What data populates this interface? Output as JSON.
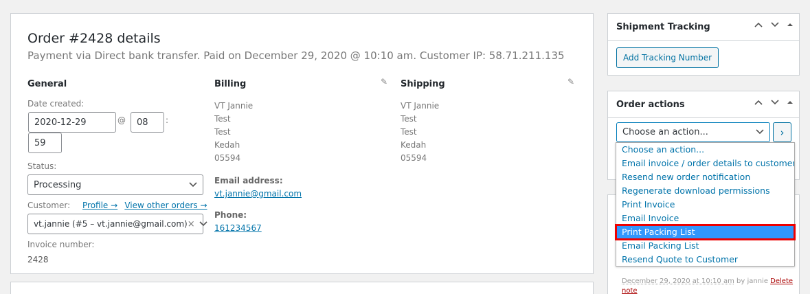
{
  "order": {
    "title": "Order #2428 details",
    "subtitle": "Payment via Direct bank transfer. Paid on December 29, 2020 @ 10:10 am. Customer IP: 58.71.211.135"
  },
  "general": {
    "heading": "General",
    "date_created_label": "Date created:",
    "date_value": "2020-12-29",
    "at_symbol": "@",
    "hour_value": "08",
    "colon": ":",
    "minute_value": "59",
    "status_label": "Status:",
    "status_value": "Processing",
    "customer_label": "Customer:",
    "profile_link": "Profile →",
    "other_orders_link": "View other orders →",
    "customer_value": "vt.jannie (#5 – vt.jannie@gmail.com)",
    "clear_glyph": "×",
    "invoice_label": "Invoice number:",
    "invoice_value": "2428"
  },
  "billing": {
    "heading": "Billing",
    "lines": [
      "VT Jannie",
      "Test",
      "Test",
      "Kedah",
      "05594"
    ],
    "email_label": "Email address:",
    "email_value": "vt.jannie@gmail.com",
    "phone_label": "Phone:",
    "phone_value": "161234567"
  },
  "shipping": {
    "heading": "Shipping",
    "lines": [
      "VT Jannie",
      "Test",
      "Test",
      "Kedah",
      "05594"
    ]
  },
  "shipment_tracking": {
    "title": "Shipment Tracking",
    "add_button": "Add Tracking Number"
  },
  "order_actions": {
    "title": "Order actions",
    "select_value": "Choose an action...",
    "go_glyph": "›",
    "options": [
      "Choose an action...",
      "Email invoice / order details to customer",
      "Resend new order notification",
      "Regenerate download permissions",
      "Print Invoice",
      "Email Invoice",
      "Print Packing List",
      "Email Packing List",
      "Resend Quote to Customer"
    ],
    "highlighted_option": "Print Packing List"
  },
  "notes": {
    "meta_text": "December 29, 2020 at 10:10 am",
    "by_text": " by jannie ",
    "delete_text": "Delete",
    "note_text": "note"
  },
  "icons": {
    "pencil": "pencil-icon",
    "chevron_down": "chevron-down-icon",
    "arrow_up": "arrow-up-icon",
    "arrow_down": "arrow-down-icon",
    "toggle": "toggle-icon"
  },
  "colors": {
    "link": "#0073aa",
    "highlight_bg": "#3297fd",
    "highlight_border": "#e00000"
  }
}
